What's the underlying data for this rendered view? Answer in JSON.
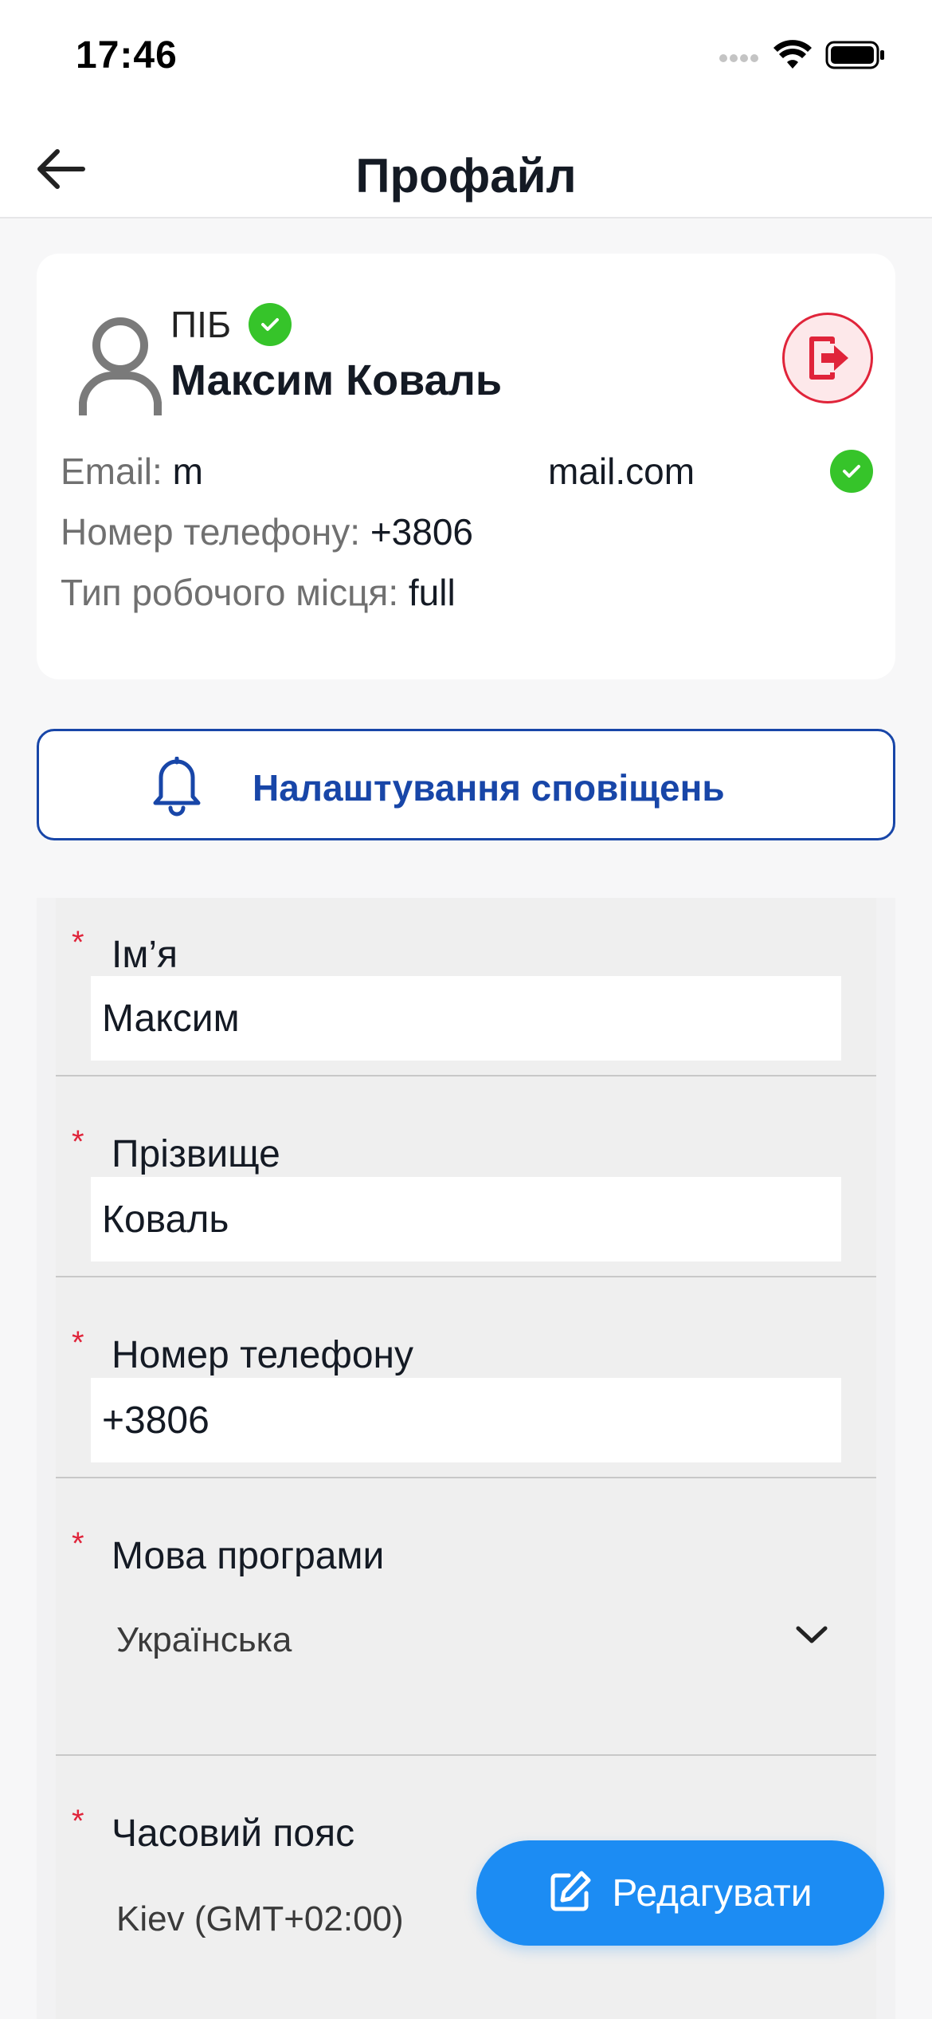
{
  "status_bar": {
    "time": "17:46"
  },
  "header": {
    "title": "Профайл"
  },
  "profile": {
    "pib_label": "ПІБ",
    "full_name": "Максим Коваль",
    "email_label": "Email:",
    "email_start": "m",
    "email_end": "mail.com",
    "phone_label": "Номер телефону:",
    "phone_value": "+3806",
    "workplace_label": "Тип робочого місця:",
    "workplace_value": "full"
  },
  "notifications": {
    "label": "Налаштування сповіщень"
  },
  "form": {
    "first_name": {
      "required": "*",
      "label": "Ім’я",
      "value": "Максим"
    },
    "last_name": {
      "required": "*",
      "label": "Прізвище",
      "value": "Коваль"
    },
    "phone": {
      "required": "*",
      "label": "Номер телефону",
      "value": "+3806"
    },
    "language": {
      "required": "*",
      "label": "Мова програми",
      "value": "Українська"
    },
    "timezone": {
      "required": "*",
      "label": "Часовий пояс",
      "value": "Kiev (GMT+02:00)"
    }
  },
  "edit_button": {
    "label": "Редагувати"
  },
  "colors": {
    "accent_blue": "#1846a8",
    "fab_blue": "#1c8cf3",
    "verified_green": "#36c42a",
    "logout_red": "#e0243a"
  },
  "icons": [
    "back-arrow-icon",
    "verified-check-icon",
    "user-avatar-icon",
    "logout-icon",
    "bell-icon",
    "chevron-down-icon",
    "edit-icon",
    "signal-icon",
    "wifi-icon",
    "battery-icon"
  ]
}
